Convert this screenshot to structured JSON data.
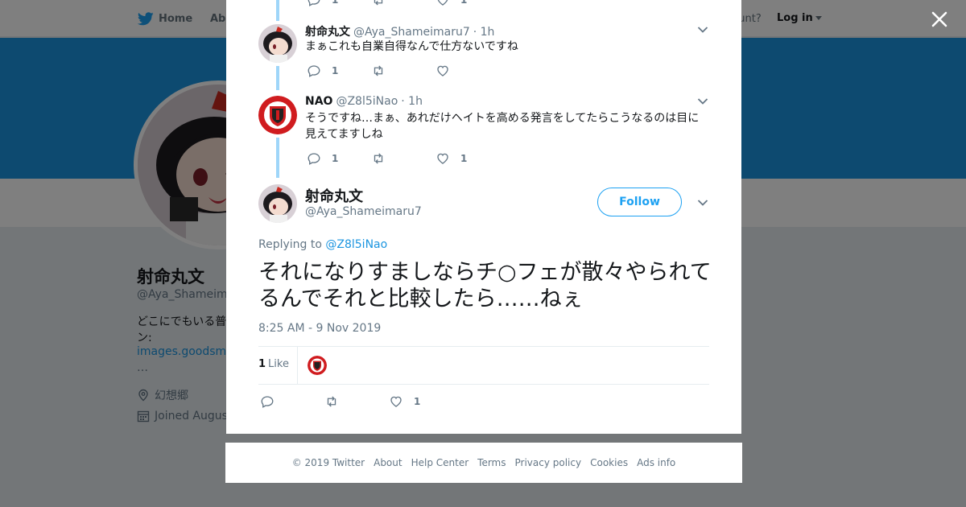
{
  "nav": {
    "home": "Home",
    "about": "Abo",
    "account_prompt": "ccount?",
    "login": "Log in"
  },
  "profile": {
    "name": "射命丸文",
    "handle": "@Aya_Shameima",
    "bio_line1": "どこにでもいる普",
    "bio_line2": "ン:",
    "bio_link": "images.goodsmile",
    "bio_ellipsis": "…",
    "location": "幻想郷",
    "joined": "Joined August"
  },
  "thread": [
    {
      "name": "射命丸文",
      "handle": "@Aya_Shameimaru7",
      "time": "· 1h",
      "text": "まぁこれも自業自得なんで仕方ないですね",
      "replies": "1",
      "retweets": "",
      "likes": ""
    },
    {
      "name": "NAO",
      "handle": "@Z8l5iNao",
      "time": "· 1h",
      "text": "そうですね…まぁ、あれだけヘイトを高める発言をしてたらこうなるのは目に見えてますしね",
      "replies": "1",
      "retweets": "",
      "likes": "1"
    }
  ],
  "top_partial": {
    "replies": "1",
    "likes": "1"
  },
  "main_tweet": {
    "name": "射命丸文",
    "handle": "@Aya_Shameimaru7",
    "follow_label": "Follow",
    "replying_prefix": "Replying to",
    "replying_to": "@Z8l5iNao",
    "text": "それになりすましならチ○フェが散々やられてるんでそれと比較したら……ねぇ",
    "date": "8:25 AM - 9 Nov 2019",
    "like_count": "1",
    "like_label": "Like",
    "replies": "",
    "retweets": "",
    "likes": "1"
  },
  "footer": {
    "copyright": "© 2019 Twitter",
    "links": [
      "About",
      "Help Center",
      "Terms",
      "Privacy policy",
      "Cookies",
      "Ads info"
    ]
  },
  "colors": {
    "accent": "#1da1f2",
    "banner": "#1b95e0",
    "thread_line": "#9fd6f9"
  }
}
